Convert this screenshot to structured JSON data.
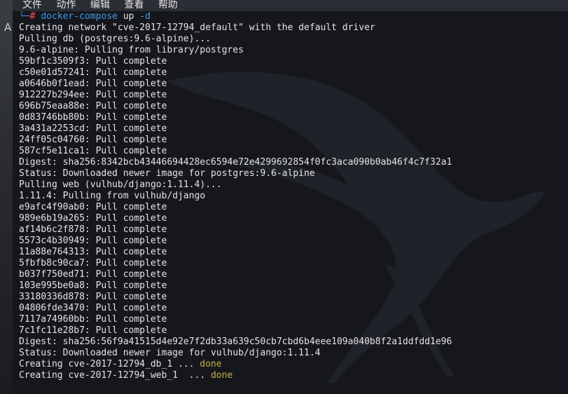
{
  "menubar": {
    "items": [
      "文件",
      "动作",
      "编辑",
      "查看",
      "帮助"
    ]
  },
  "desktop": {
    "letter": "A"
  },
  "prompt": {
    "corner": "└─",
    "symbol": "#",
    "command": "docker-compose",
    "args": " up ",
    "flag": "-d"
  },
  "output": [
    "Creating network \"cve-2017-12794_default\" with the default driver",
    "Pulling db (postgres:9.6-alpine)...",
    "9.6-alpine: Pulling from library/postgres",
    "59bf1c3509f3: Pull complete",
    "c50e01d57241: Pull complete",
    "a0646b0f1ead: Pull complete",
    "912227b294ee: Pull complete",
    "696b75eaa88e: Pull complete",
    "0d83746bb80b: Pull complete",
    "3a431a2253cd: Pull complete",
    "24ff05c04760: Pull complete",
    "587cf5e11ca1: Pull complete",
    "Digest: sha256:8342bcb43446694428ec6594e72e4299692854f0fc3aca090b0ab46f4c7f32a1",
    "Status: Downloaded newer image for postgres:9.6-alpine",
    "Pulling web (vulhub/django:1.11.4)...",
    "1.11.4: Pulling from vulhub/django",
    "e9afc4f90ab0: Pull complete",
    "989e6b19a265: Pull complete",
    "af14b6c2f878: Pull complete",
    "5573c4b30949: Pull complete",
    "11a88e764313: Pull complete",
    "5fbfb8c90ca7: Pull complete",
    "b037f750ed71: Pull complete",
    "103e995be0a8: Pull complete",
    "33180336d878: Pull complete",
    "04806fde3470: Pull complete",
    "7117a74960bb: Pull complete",
    "7c1fc11e28b7: Pull complete",
    "Digest: sha256:56f9a41515d4e92e7f2db33a639c50cb7cbd6b4eee109a040b8f2a1ddfdd1e96",
    "Status: Downloaded newer image for vulhub/django:1.11.4"
  ],
  "creating": [
    {
      "text": "Creating cve-2017-12794_db_1 ... ",
      "status": "done"
    },
    {
      "text": "Creating cve-2017-12794_web_1  ... ",
      "status": "done"
    }
  ],
  "colors": {
    "prompt_blue": "#3f9be8",
    "hash_red": "#e23c3c",
    "done_yellow": "#c8b042"
  }
}
